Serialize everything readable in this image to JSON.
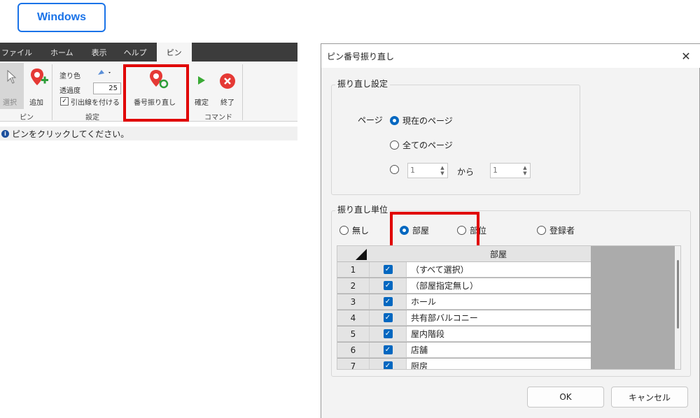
{
  "tag": {
    "label": "Windows"
  },
  "ribbon": {
    "tabs": [
      "ファイル",
      "ホーム",
      "表示",
      "ヘルプ",
      "ピン"
    ],
    "select_label": "選択",
    "add_label": "追加",
    "fill_label": "塗り色",
    "opacity_label": "透過度",
    "opacity_value": "25",
    "leader_label": "引出線を付ける",
    "renumber_label": "番号振り直し",
    "confirm_label": "確定",
    "exit_label": "終了",
    "group_pin": "ピン",
    "group_settings": "設定",
    "group_command": "コマンド"
  },
  "status": {
    "text": "ピンをクリックしてください。"
  },
  "dialog": {
    "title": "ピン番号振り直し",
    "close_glyph": "✕",
    "settings_group": "振り直し設定",
    "page_label": "ページ",
    "opt_current": "現在のページ",
    "opt_all": "全てのページ",
    "range_from": "1",
    "range_to": "1",
    "range_mid": "から",
    "unit_group": "振り直し単位",
    "unit_none": "無し",
    "unit_room": "部屋",
    "unit_part": "部位",
    "unit_registrant": "登録者",
    "grid_header": "部屋",
    "rows": [
      {
        "num": "1",
        "text": "（すべて選択）"
      },
      {
        "num": "2",
        "text": "（部屋指定無し）"
      },
      {
        "num": "3",
        "text": "ホール"
      },
      {
        "num": "4",
        "text": "共有部バルコニー"
      },
      {
        "num": "5",
        "text": "屋内階段"
      },
      {
        "num": "6",
        "text": "店舗"
      },
      {
        "num": "7",
        "text": "厨房"
      }
    ],
    "ok_label": "OK",
    "cancel_label": "キャンセル"
  },
  "colors": {
    "accent": "#0067c0",
    "highlight": "#e00000",
    "tag": "#1a73e8",
    "ribbon_dark": "#3c3c3c"
  },
  "icons": [
    "cursor-icon",
    "pin-add-icon",
    "fill-bucket-icon",
    "pin-renumber-icon",
    "play-icon",
    "close-circle-icon",
    "info-icon"
  ]
}
